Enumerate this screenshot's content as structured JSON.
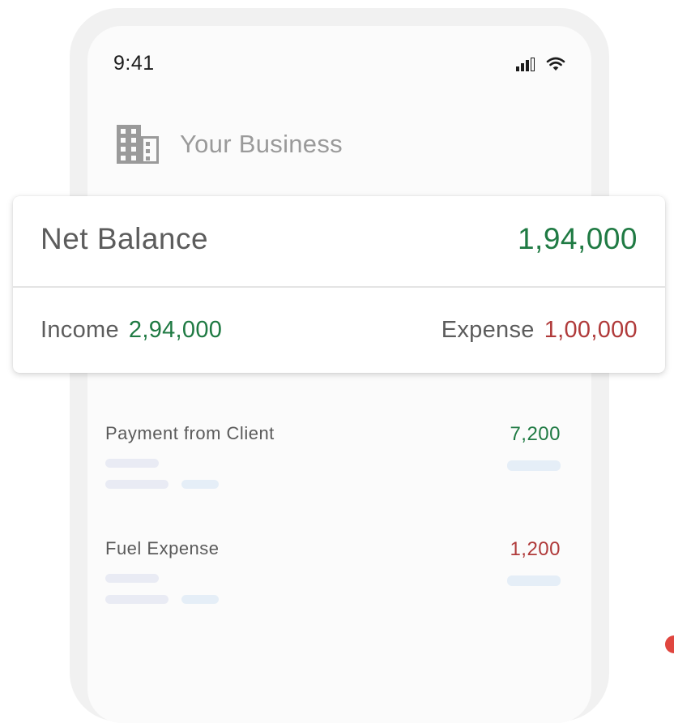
{
  "status_bar": {
    "time": "9:41",
    "icons": [
      "signal-icon",
      "wifi-icon"
    ]
  },
  "header": {
    "business_name": "Your Business",
    "icon": "building-icon"
  },
  "summary": {
    "net_label": "Net Balance",
    "net_value": "1,94,000",
    "income_label": "Income",
    "income_value": "2,94,000",
    "expense_label": "Expense",
    "expense_value": "1,00,000"
  },
  "transactions": [
    {
      "title": "Payment from Client",
      "amount": "7,200",
      "type": "income"
    },
    {
      "title": "Fuel Expense",
      "amount": "1,200",
      "type": "expense"
    }
  ],
  "colors": {
    "income": "#1f7a43",
    "expense": "#b03a3a",
    "accent_dot": "#e0463f"
  }
}
